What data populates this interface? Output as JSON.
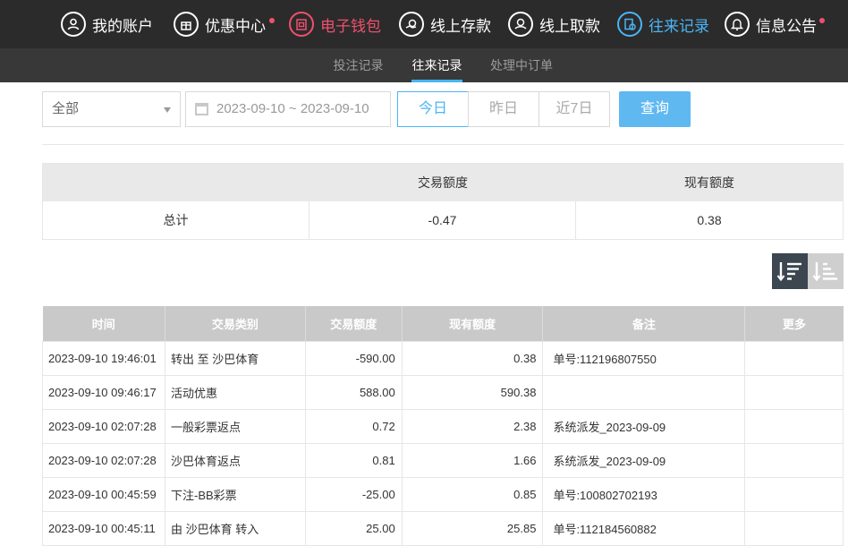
{
  "nav": {
    "items": [
      {
        "label": "我的账户",
        "icon": "user-icon"
      },
      {
        "label": "优惠中心",
        "icon": "gift-icon",
        "badge": true
      },
      {
        "label": "电子钱包",
        "icon": "wallet-icon"
      },
      {
        "label": "线上存款",
        "icon": "deposit-icon"
      },
      {
        "label": "线上取款",
        "icon": "withdraw-icon"
      },
      {
        "label": "往来记录",
        "icon": "record-icon"
      },
      {
        "label": "信息公告",
        "icon": "bell-icon",
        "badge": true
      }
    ],
    "active_color": "#f0506e",
    "selected_color": "#4ab4f5"
  },
  "subnav": {
    "items": [
      "投注记录",
      "往来记录",
      "处理中订单"
    ],
    "active": "往来记录"
  },
  "filters": {
    "type_select": "全部",
    "date_range": "2023-09-10 ~ 2023-09-10",
    "quick": [
      "今日",
      "昨日",
      "近7日"
    ],
    "quick_active": "今日",
    "search_label": "查询"
  },
  "summary": {
    "headers": [
      "",
      "交易额度",
      "现有额度"
    ],
    "row": [
      "总计",
      "-0.47",
      "0.38"
    ]
  },
  "sort": {
    "desc_icon": "sort-desc-icon",
    "asc_icon": "sort-asc-icon"
  },
  "records": {
    "headers": [
      "时间",
      "交易类别",
      "交易额度",
      "现有额度",
      "备注",
      "更多"
    ],
    "rows": [
      [
        "2023-09-10 19:46:01",
        "转出 至 沙巴体育",
        "-590.00",
        "0.38",
        "单号:112196807550",
        ""
      ],
      [
        "2023-09-10 09:46:17",
        "活动优惠",
        "588.00",
        "590.38",
        "",
        ""
      ],
      [
        "2023-09-10 02:07:28",
        "一般彩票返点",
        "0.72",
        "2.38",
        "系统派发_2023-09-09",
        ""
      ],
      [
        "2023-09-10 02:07:28",
        "沙巴体育返点",
        "0.81",
        "1.66",
        "系统派发_2023-09-09",
        ""
      ],
      [
        "2023-09-10 00:45:59",
        "下注-BB彩票",
        "-25.00",
        "0.85",
        "单号:100802702193",
        ""
      ],
      [
        "2023-09-10 00:45:11",
        "由 沙巴体育 转入",
        "25.00",
        "25.85",
        "单号:112184560882",
        ""
      ]
    ]
  }
}
